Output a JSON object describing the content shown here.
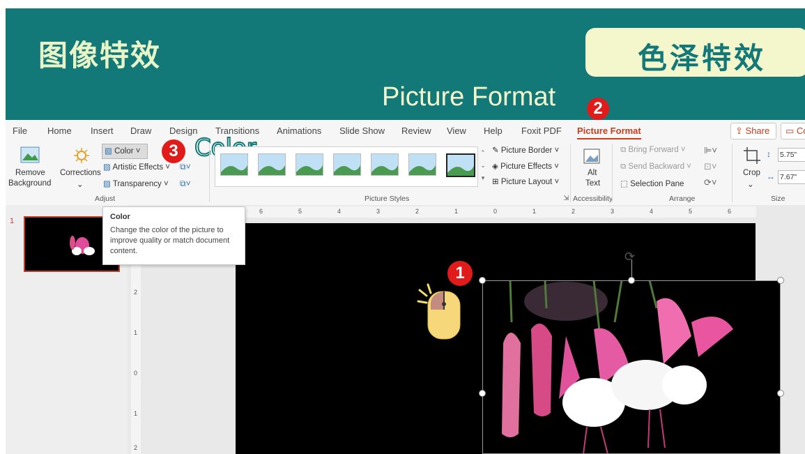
{
  "banner": {
    "title": "图像特效",
    "badge": "色泽特效",
    "subtitle": "Picture Format"
  },
  "steps": {
    "one": "1",
    "two": "2",
    "three": "3",
    "three_label": "Color"
  },
  "tabs": [
    "File",
    "Home",
    "Insert",
    "Draw",
    "Design",
    "Transitions",
    "Animations",
    "Slide Show",
    "Review",
    "View",
    "Help",
    "Foxit PDF",
    "Picture Format"
  ],
  "share": {
    "share_label": "Share",
    "comments_label": "Co"
  },
  "ribbon": {
    "remove_bg": [
      "Remove",
      "Background"
    ],
    "corrections": "Corrections",
    "color": "Color",
    "artistic": "Artistic Effects",
    "transparency": "Transparency",
    "adjust_group": "Adjust",
    "picture_border": "Picture Border",
    "picture_effects": "Picture Effects",
    "picture_layout": "Picture Layout",
    "styles_group": "Picture Styles",
    "alt": "Alt",
    "alt_text": "Text",
    "accessibility_group": "Accessibility",
    "bring_forward": "Bring Forward",
    "send_backward": "Send Backward",
    "selection_pane": "Selection Pane",
    "arrange_group": "Arrange",
    "crop": "Crop",
    "height": "5.75\"",
    "width": "7.67\"",
    "size_group": "Size"
  },
  "tooltip": {
    "title": "Color",
    "body": "Change the color of the picture to improve quality or match document content."
  },
  "thumbs": {
    "slide_number": "1"
  },
  "ruler": {
    "h_ticks": [
      "6",
      "5",
      "4",
      "3",
      "2",
      "1",
      "0",
      "1",
      "2",
      "3",
      "4",
      "5",
      "6"
    ],
    "v_ticks": [
      "2",
      "1",
      "0",
      "1",
      "2"
    ]
  },
  "colors": {
    "banner": "#137878",
    "badge_bg": "#f4f6cc",
    "accent_tab": "#c43e1c",
    "step_circle": "#e11a1a"
  }
}
